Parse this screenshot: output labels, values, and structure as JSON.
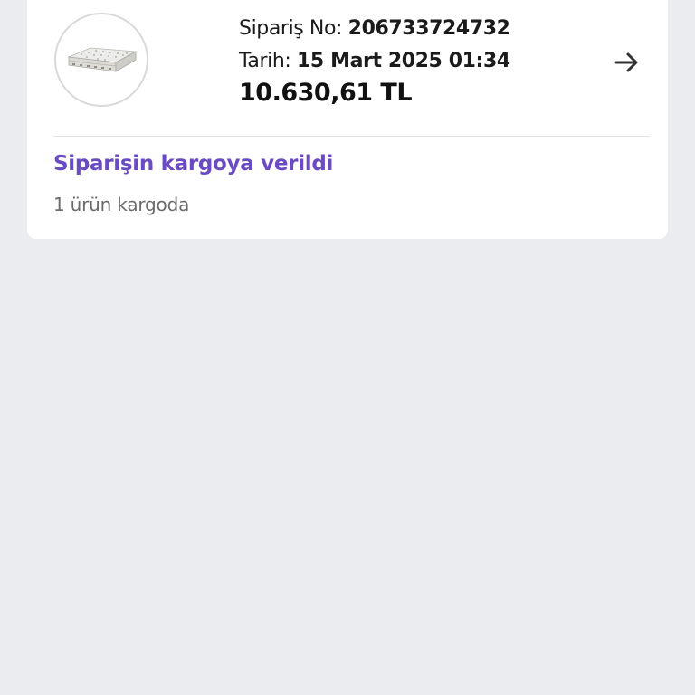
{
  "order": {
    "order_no_label": "Sipariş No:",
    "order_no": "206733724732",
    "date_label": "Tarih:",
    "date": "15 Mart 2025 01:34",
    "total": "10.630,61 TL",
    "product_image_icon": "mattress-image",
    "detail_icon": "arrow-right-icon",
    "status": "Siparişin kargoya verildi",
    "substatus": "1 ürün kargoda"
  },
  "colors": {
    "background": "#ebecf0",
    "card": "#ffffff",
    "status_accent": "#6a4bc4"
  }
}
